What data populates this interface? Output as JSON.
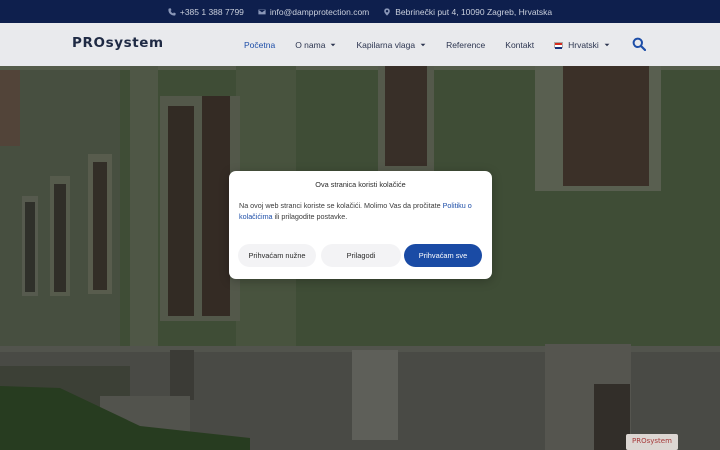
{
  "topbar": {
    "phone": "+385 1 388 7799",
    "email": "info@dampprotection.com",
    "address": "Bebrinečki put 4, 10090 Zagreb, Hrvatska"
  },
  "header": {
    "logo": "PROsystem",
    "nav": [
      {
        "label": "Početna",
        "active": true,
        "dropdown": false
      },
      {
        "label": "O nama",
        "active": false,
        "dropdown": true
      },
      {
        "label": "Kapilarna vlaga",
        "active": false,
        "dropdown": true
      },
      {
        "label": "Reference",
        "active": false,
        "dropdown": false
      },
      {
        "label": "Kontakt",
        "active": false,
        "dropdown": false
      }
    ],
    "language": "Hrvatski"
  },
  "cookie_modal": {
    "title": "Ova stranica koristi kolačiće",
    "text_before": "Na ovoj web stranci koriste se kolačići. Molimo Vas da pročitate ",
    "link": "Politiku o kolačićima",
    "text_after": " ili prilagodite postavke.",
    "btn_necessary": "Prihvaćam nužne",
    "btn_customize": "Prilagodi",
    "btn_accept": "Prihvaćam sve"
  },
  "corner_badge": "PROsystem",
  "colors": {
    "topbar_bg": "#0e1f4d",
    "accent": "#1a4ba5",
    "nav_active": "#1d4ea8"
  }
}
